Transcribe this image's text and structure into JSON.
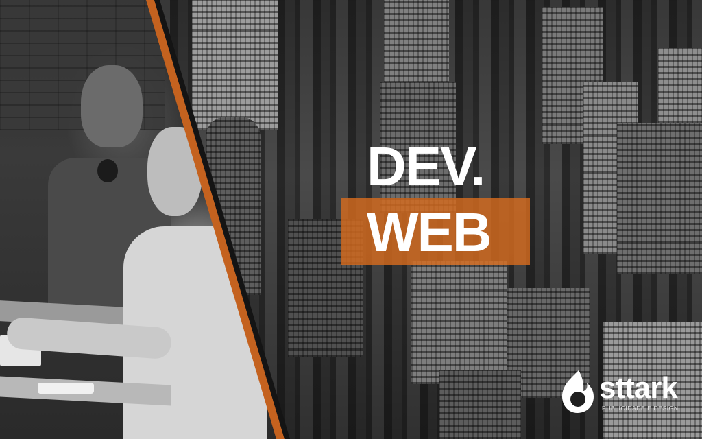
{
  "headline": {
    "line1": "DEV.",
    "line2": "WEB"
  },
  "brand": {
    "name": "sttark",
    "tagline": "PUBLICIDADE E DESIGN"
  },
  "colors": {
    "accent": "#D66B1E",
    "text": "#FFFFFF"
  }
}
